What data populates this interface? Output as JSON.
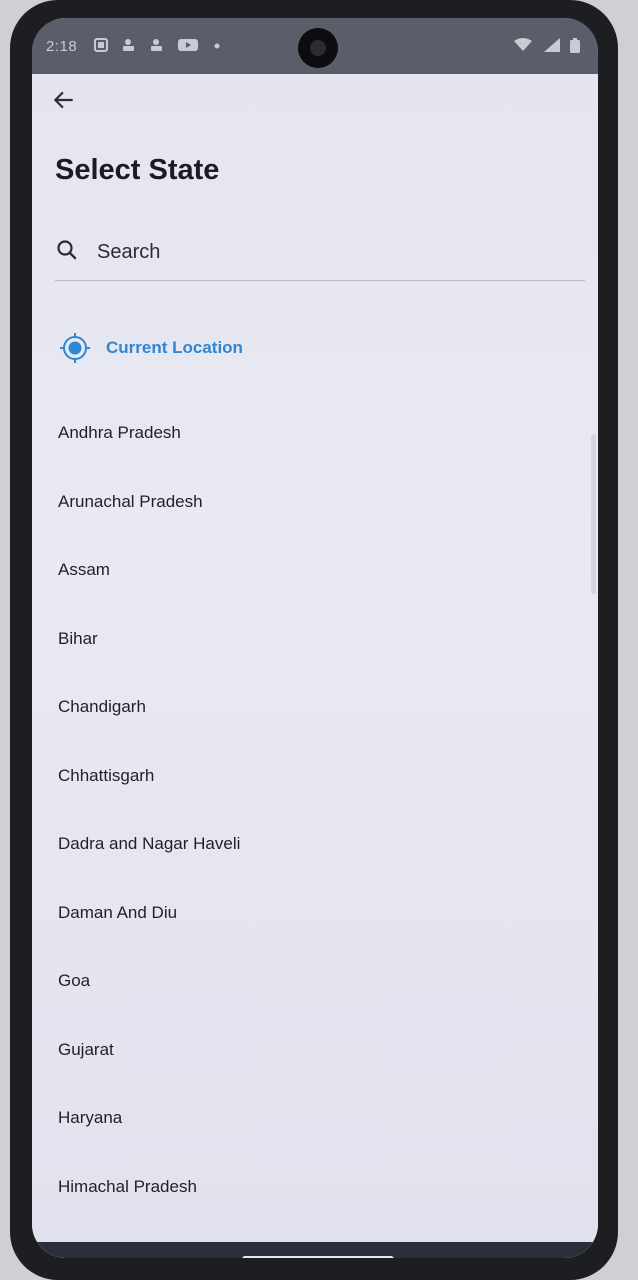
{
  "status_bar": {
    "time": "2:18",
    "notification_icons": [
      "gallery-icon",
      "teams-icon",
      "teams-icon",
      "youtube-icon",
      "dot-icon"
    ],
    "system_icons": [
      "wifi-icon",
      "signal-icon",
      "battery-icon"
    ]
  },
  "header": {
    "back_icon": "arrow-left-icon",
    "title": "Select State"
  },
  "search": {
    "placeholder": "Search",
    "value": ""
  },
  "current_location": {
    "label": "Current Location",
    "icon": "gps-target-icon",
    "color": "#2d86d6"
  },
  "states": [
    {
      "label": "Andhra Pradesh"
    },
    {
      "label": "Arunachal Pradesh"
    },
    {
      "label": "Assam"
    },
    {
      "label": "Bihar"
    },
    {
      "label": "Chandigarh"
    },
    {
      "label": "Chhattisgarh"
    },
    {
      "label": "Dadra and Nagar Haveli"
    },
    {
      "label": "Daman And Diu"
    },
    {
      "label": "Goa"
    },
    {
      "label": "Gujarat"
    },
    {
      "label": "Haryana"
    },
    {
      "label": "Himachal Pradesh"
    }
  ]
}
